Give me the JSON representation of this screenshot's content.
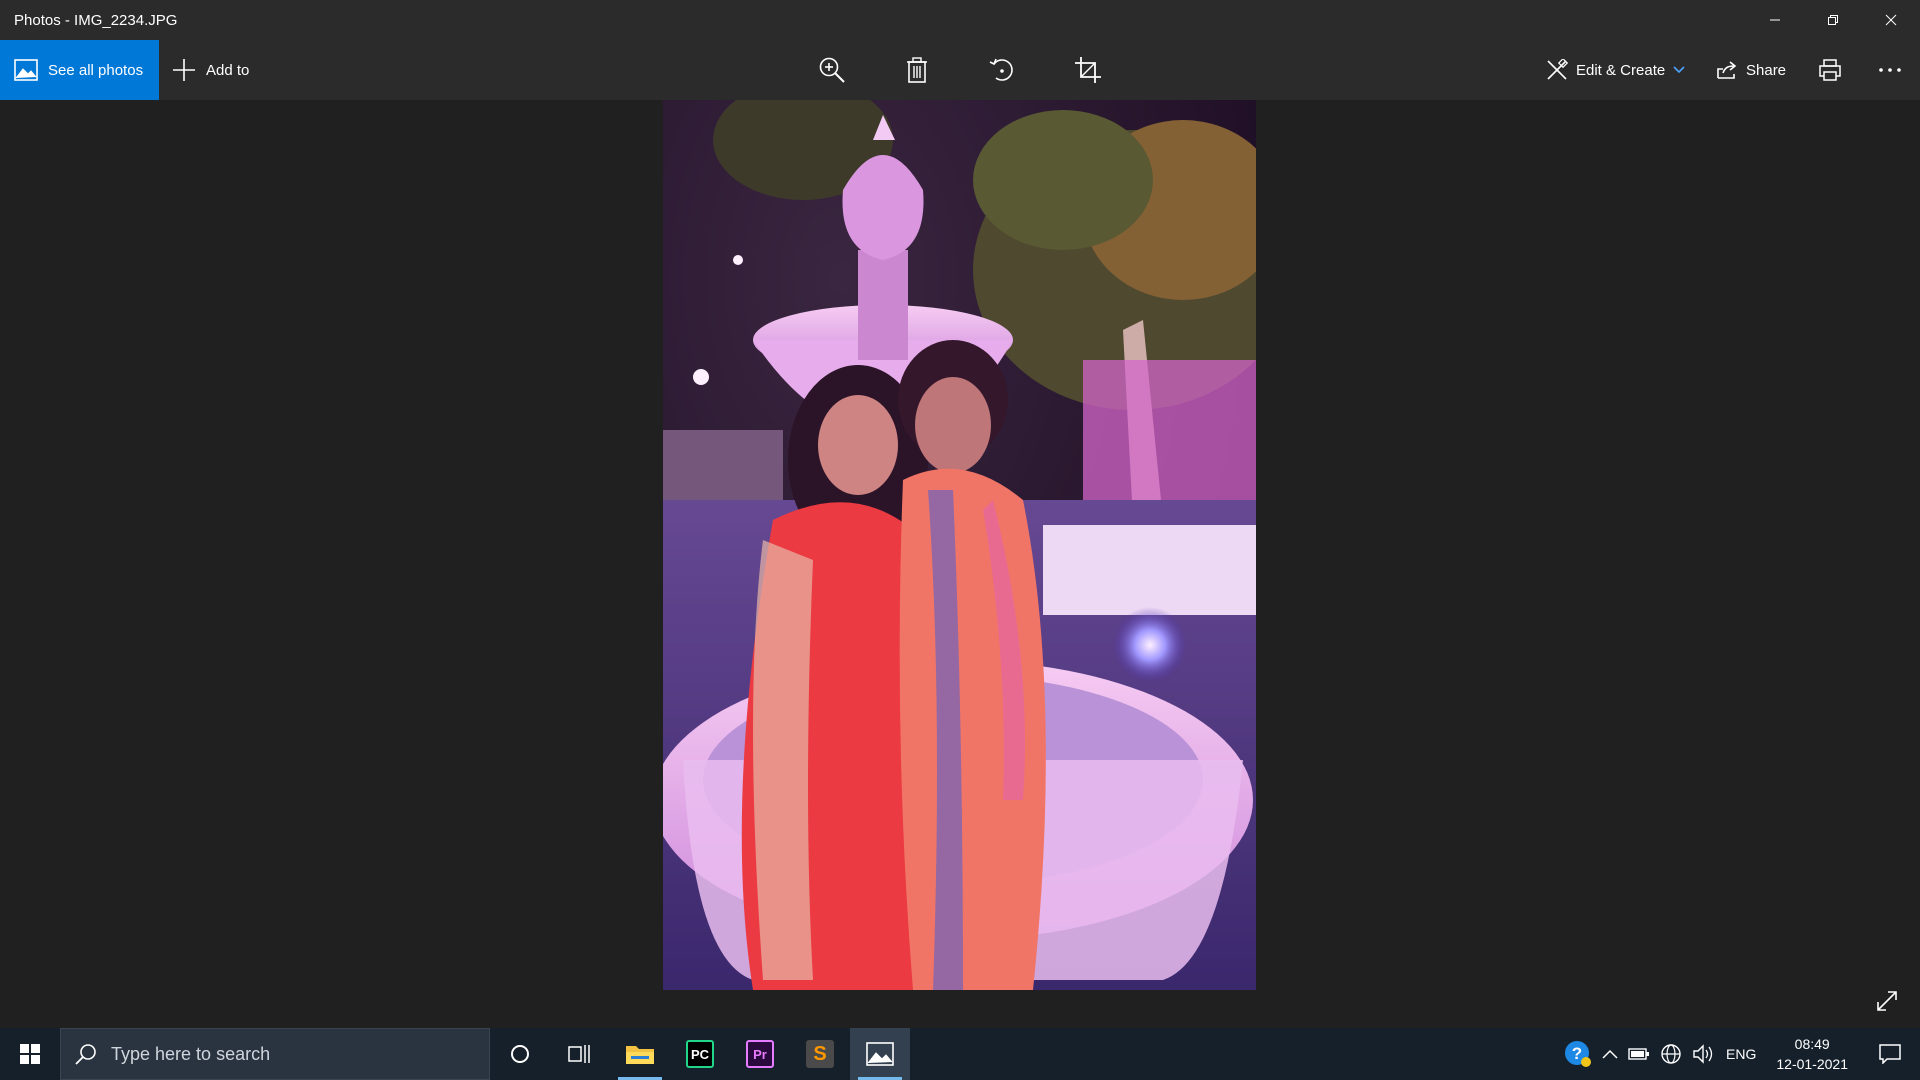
{
  "window": {
    "title": "Photos - IMG_2234.JPG"
  },
  "toolbar": {
    "see_all_label": "See all photos",
    "add_to_label": "Add to",
    "zoom_icon": "zoom-in-icon",
    "delete_icon": "delete-icon",
    "rotate_icon": "rotate-icon",
    "crop_icon": "crop-icon",
    "edit_create_label": "Edit & Create",
    "share_label": "Share",
    "print_icon": "print-icon",
    "more_icon": "more-icon"
  },
  "taskbar": {
    "search_placeholder": "Type here to search",
    "language": "ENG",
    "time": "08:49",
    "date": "12-01-2021",
    "apps": [
      "file-explorer",
      "pycharm",
      "premiere-pro",
      "sublime-text",
      "photos"
    ]
  },
  "colors": {
    "accent": "#0078d7",
    "toolbar_bg": "#2b2b2b",
    "viewer_bg": "#202020",
    "taskbar_bg": "#15202b"
  }
}
